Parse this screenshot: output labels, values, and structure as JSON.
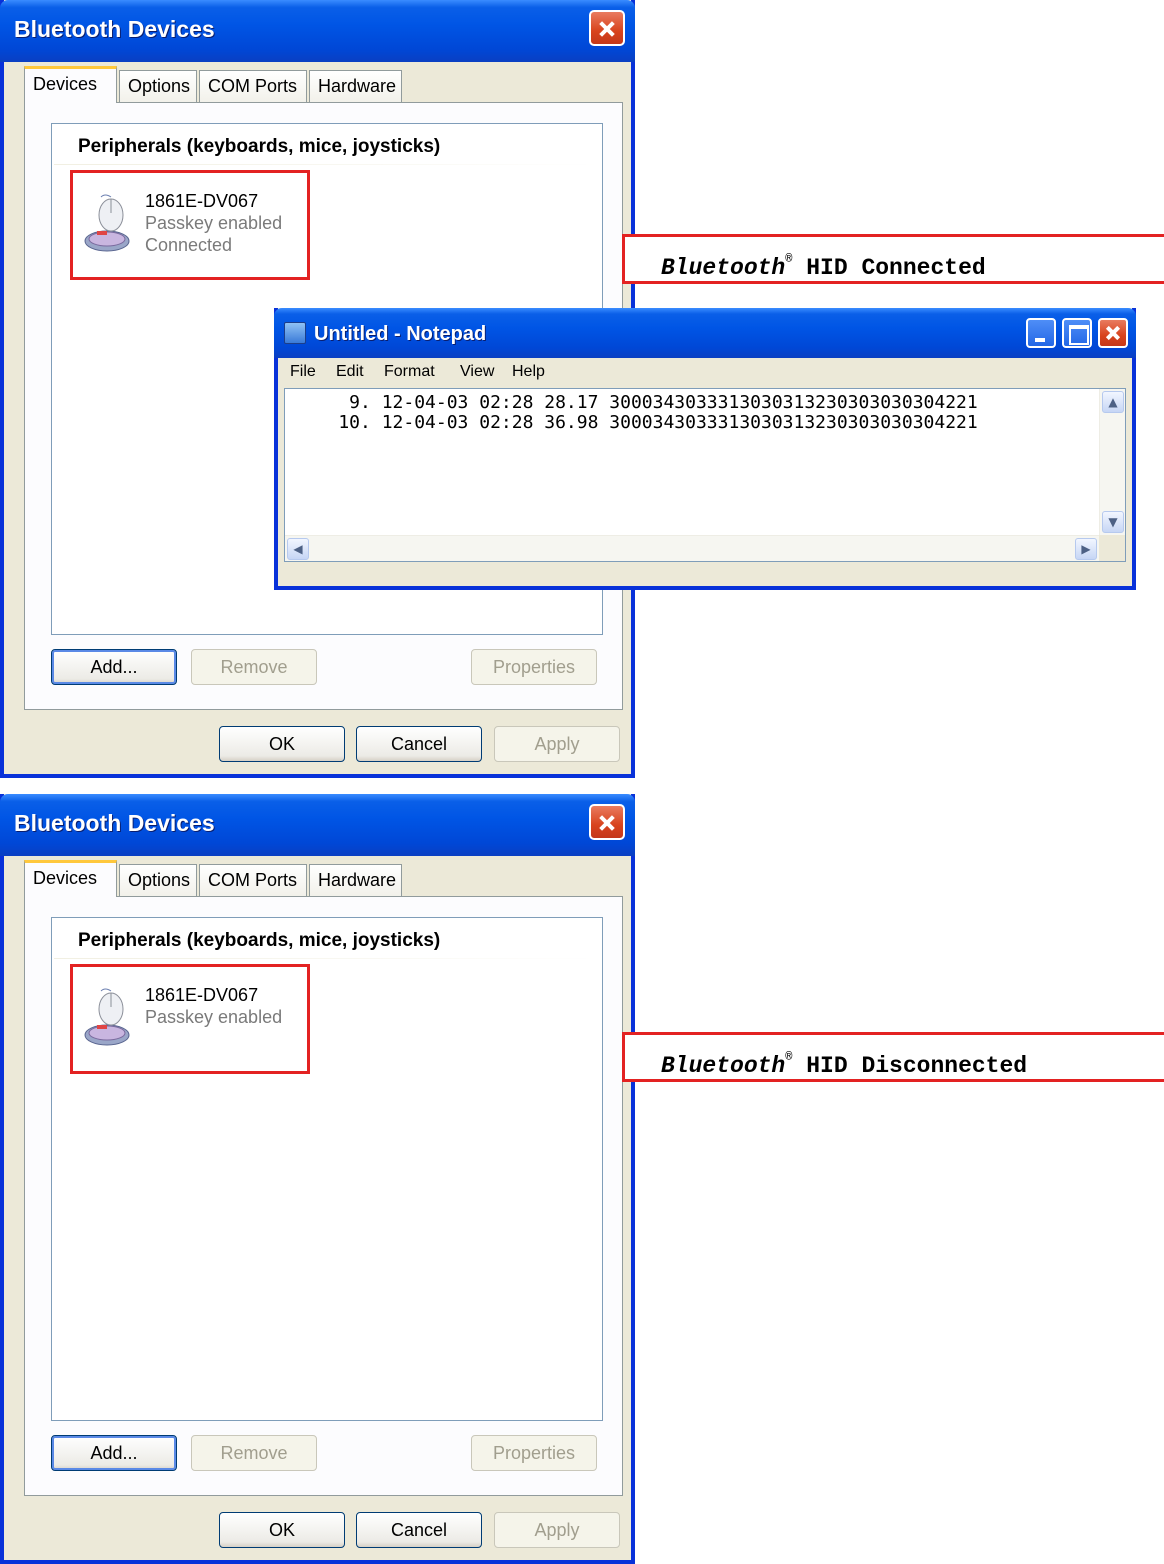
{
  "dialog_title": "Bluetooth Devices",
  "tabs": [
    "Devices",
    "Options",
    "COM Ports",
    "Hardware"
  ],
  "list_header": "Peripherals (keyboards, mice, joysticks)",
  "device": {
    "name": "1861E-DV067",
    "status_passkey": "Passkey enabled",
    "status_connected": "Connected"
  },
  "buttons": {
    "add": "Add...",
    "remove": "Remove",
    "properties": "Properties",
    "ok": "OK",
    "cancel": "Cancel",
    "apply": "Apply"
  },
  "annotations": {
    "brand": "Bluetooth",
    "registered": "®",
    "connected_suffix": " HID Connected",
    "disconnected_suffix": " HID Disconnected"
  },
  "notepad": {
    "title": "Untitled - Notepad",
    "menu": [
      "File",
      "Edit",
      "Format",
      "View",
      "Help"
    ],
    "lines": [
      "     9. 12-04-03 02:28 28.17 3000343033313030313230303030304221",
      "    10. 12-04-03 02:28 36.98 3000343033313030313230303030304221"
    ]
  },
  "colors": {
    "highlight": "#e32222",
    "xp_blue": "#0055e5",
    "dialog_bg": "#ece9d8"
  }
}
